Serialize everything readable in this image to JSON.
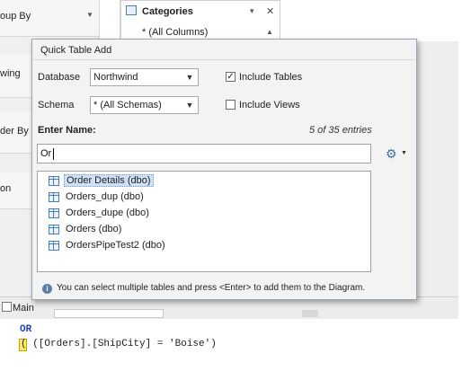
{
  "background": {
    "left_groups": [
      "oup By",
      "wing",
      "der By",
      "on"
    ],
    "categories": {
      "title": "Categories",
      "first_row": "* (All Columns)",
      "close_glyph": "✕",
      "pin_glyph": "▾",
      "scroll_up_glyph": "▲"
    },
    "bottom_tab": "Main",
    "code_lines": [
      "OR",
      "( ([Orders].[ShipCity] = 'Boise')"
    ]
  },
  "popup": {
    "title": "Quick Table Add",
    "database": {
      "label": "Database",
      "value": "Northwind"
    },
    "schema": {
      "label": "Schema",
      "value": "* (All Schemas)"
    },
    "include_tables": {
      "label": "Include Tables",
      "checked": true
    },
    "include_views": {
      "label": "Include Views",
      "checked": false
    },
    "enter_name": {
      "label": "Enter Name:",
      "value": "Or",
      "count": "5 of 35 entries"
    },
    "results": [
      {
        "name": "Order Details (dbo)",
        "selected": true
      },
      {
        "name": "Orders_dup (dbo)",
        "selected": false
      },
      {
        "name": "Orders_dupe (dbo)",
        "selected": false
      },
      {
        "name": "Orders (dbo)",
        "selected": false
      },
      {
        "name": "OrdersPipeTest2 (dbo)",
        "selected": false
      }
    ],
    "hint": "You can select multiple tables and press <Enter> to add them to the Diagram.",
    "icons": {
      "settings": "gear-icon",
      "info": "info-icon"
    }
  }
}
